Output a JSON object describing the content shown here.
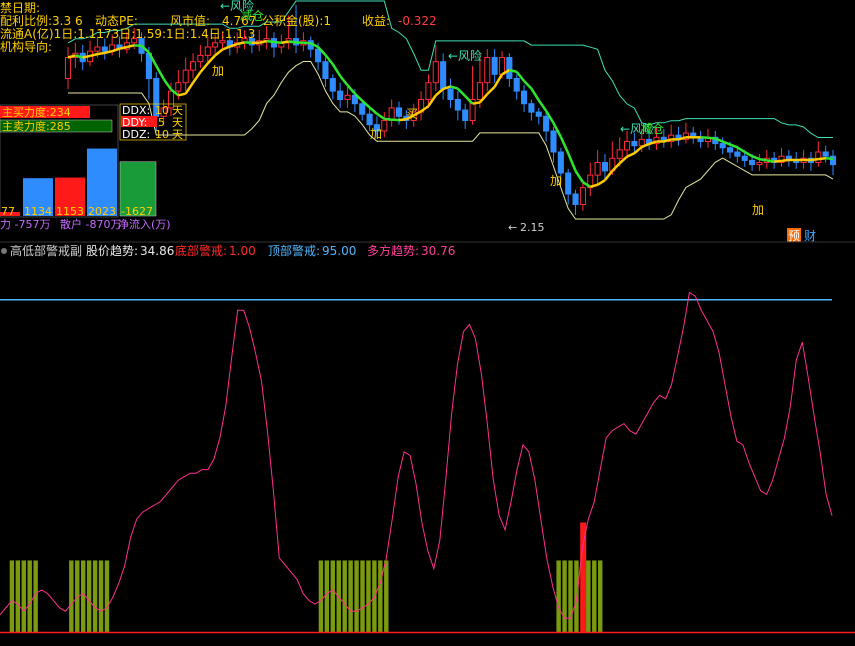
{
  "upper_panel": {
    "info_lines": {
      "line1": "禁日期:",
      "line2": "配利比例:3.3  6",
      "line2b": "动态PE:",
      "line3": "流通A(亿)1日:1.1173日:1.59:1日:1.4日:1.1.3",
      "line4": "机构导向:",
      "market_value_label": "风市值:",
      "market_value": "4.767",
      "fund_label": "公积金(股):1",
      "income_label": "收益:",
      "income_value": "-0.322"
    },
    "annotations": {
      "risk1": "←风险",
      "risk2": "←风险",
      "risk3": "←风险",
      "harvest1": "减仓",
      "harvest2": "减仓",
      "add1": "加",
      "add2": "加",
      "add3": "加",
      "add4": "加",
      "buy": "买",
      "low_price": "2.15",
      "badge_pre": "预",
      "badge_fin": "财"
    },
    "power_box": {
      "buy_force": "主买力度:234",
      "sell_force": "主卖力度:285",
      "ddx_label": "DDX:",
      "ddy_label": "DDY:",
      "ddz_label": "DDZ:",
      "ddx_val": "10",
      "ddy_val": "5",
      "ddz_val": "10",
      "day1": "天",
      "day2": "天",
      "day3": "天",
      "bar_labels": [
        "77",
        "1134",
        "1153",
        "2023",
        "-1627"
      ],
      "bar_values": [
        -77,
        1134,
        1153,
        2023,
        -1627
      ],
      "bottom_line1": "力 -757万",
      "bottom_line2": "散户 -870万",
      "bottom_line3": "净流入(万)"
    }
  },
  "indicator_header": {
    "name": "高低部警戒副",
    "trend_label": "股价趋势:",
    "trend_value": "34.86",
    "bottom_label": "底部警戒:",
    "bottom_value": "1.00",
    "top_label": "顶部警戒:",
    "top_value": "95.00",
    "multi_label": "多方趋势:",
    "multi_value": "30.76"
  },
  "colors": {
    "up": "#ff2a3a",
    "down": "#2f8cff",
    "ma_green": "#2ee62e",
    "ma_yellow": "#ffcc00",
    "band_cyan": "#3fe0b6",
    "band_pink": "#ff4d7d",
    "oscillator": "#ff2f8f",
    "top_line": "#4fb7ff",
    "bottom_line": "#ff1a1a",
    "warn_bar": "#7a9a10",
    "signal_bar": "#ff1a1a"
  },
  "chart_data": {
    "type": "line",
    "title": "高低部警戒副",
    "series": [
      {
        "name": "股价趋势",
        "values": [
          6,
          8,
          10,
          9,
          7,
          9,
          12,
          13,
          12,
          10,
          8,
          7,
          9,
          11,
          12,
          10,
          8,
          7,
          8,
          11,
          15,
          20,
          28,
          33,
          35,
          36,
          37,
          38,
          40,
          42,
          44,
          45,
          46,
          46,
          47,
          47,
          50,
          56,
          65,
          79,
          92,
          92,
          87,
          80,
          72,
          58,
          41,
          22,
          20,
          18,
          16,
          12,
          10,
          9,
          10,
          12,
          13,
          11,
          9,
          7,
          7,
          8,
          9,
          11,
          15,
          22,
          33,
          45,
          52,
          51,
          43,
          32,
          24,
          19,
          27,
          44,
          63,
          77,
          86,
          88,
          84,
          74,
          60,
          44,
          34,
          30,
          38,
          47,
          54,
          52,
          44,
          33,
          22,
          14,
          8,
          5,
          5,
          10,
          25,
          33,
          38,
          47,
          56,
          58,
          59,
          60,
          58,
          57,
          60,
          63,
          66,
          68,
          67,
          71,
          79,
          87,
          97,
          96,
          92,
          89,
          86,
          80,
          71,
          62,
          55,
          54,
          49,
          45,
          41,
          40,
          44,
          50,
          56,
          65,
          78,
          83,
          73,
          62,
          52,
          40,
          34
        ]
      }
    ],
    "reference_lines": [
      {
        "name": "顶部警戒",
        "value": 95
      },
      {
        "name": "底部警戒",
        "value": 1
      }
    ],
    "signal_bar_indices": [
      2,
      3,
      4,
      5,
      6,
      12,
      13,
      14,
      15,
      16,
      17,
      18,
      54,
      55,
      56,
      57,
      58,
      59,
      60,
      61,
      62,
      63,
      64,
      65,
      94,
      95,
      96,
      97,
      98,
      99,
      100,
      101
    ],
    "strong_signal_indices": [
      98
    ],
    "ylim": [
      0,
      100
    ]
  },
  "price_chart": {
    "type": "candlestick",
    "low_marker": 2.15,
    "candles": [
      [
        2.8,
        2.9,
        2.75,
        2.95
      ],
      [
        2.9,
        2.92,
        2.85,
        2.97
      ],
      [
        2.92,
        2.88,
        2.84,
        2.96
      ],
      [
        2.88,
        2.93,
        2.86,
        2.98
      ],
      [
        2.93,
        2.95,
        2.9,
        3.0
      ],
      [
        2.95,
        2.93,
        2.89,
        2.99
      ],
      [
        2.93,
        2.96,
        2.91,
        3.01
      ],
      [
        2.96,
        2.94,
        2.9,
        3.0
      ],
      [
        2.94,
        2.97,
        2.92,
        3.02
      ],
      [
        2.97,
        2.99,
        2.94,
        3.04
      ],
      [
        2.99,
        2.92,
        2.88,
        3.02
      ],
      [
        2.92,
        2.8,
        2.7,
        2.95
      ],
      [
        2.8,
        2.62,
        2.55,
        2.83
      ],
      [
        2.62,
        2.66,
        2.58,
        2.7
      ],
      [
        2.66,
        2.74,
        2.62,
        2.78
      ],
      [
        2.74,
        2.78,
        2.7,
        2.84
      ],
      [
        2.78,
        2.84,
        2.74,
        2.9
      ],
      [
        2.84,
        2.88,
        2.8,
        2.92
      ],
      [
        2.88,
        2.91,
        2.85,
        2.96
      ],
      [
        2.91,
        2.95,
        2.88,
        3.0
      ],
      [
        2.95,
        2.97,
        2.92,
        3.01
      ],
      [
        2.97,
        2.98,
        2.94,
        3.02
      ],
      [
        2.98,
        2.95,
        2.91,
        3.01
      ],
      [
        2.95,
        2.97,
        2.92,
        3.02
      ],
      [
        2.97,
        2.99,
        2.94,
        3.03
      ],
      [
        2.99,
        2.96,
        2.92,
        3.02
      ],
      [
        2.96,
        2.98,
        2.93,
        3.03
      ],
      [
        2.98,
        2.99,
        2.94,
        3.05
      ],
      [
        2.99,
        2.95,
        2.9,
        3.02
      ],
      [
        2.95,
        2.97,
        2.92,
        3.01
      ],
      [
        2.97,
        2.99,
        2.94,
        3.1
      ],
      [
        2.99,
        2.96,
        2.92,
        3.15
      ],
      [
        2.96,
        2.98,
        2.93,
        3.02
      ],
      [
        2.98,
        2.94,
        2.9,
        3.0
      ],
      [
        2.94,
        2.88,
        2.84,
        2.97
      ],
      [
        2.88,
        2.8,
        2.76,
        2.9
      ],
      [
        2.8,
        2.74,
        2.7,
        2.82
      ],
      [
        2.74,
        2.7,
        2.66,
        2.78
      ],
      [
        2.7,
        2.72,
        2.66,
        2.76
      ],
      [
        2.72,
        2.68,
        2.64,
        2.75
      ],
      [
        2.68,
        2.63,
        2.6,
        2.7
      ],
      [
        2.63,
        2.58,
        2.55,
        2.66
      ],
      [
        2.58,
        2.55,
        2.52,
        2.62
      ],
      [
        2.55,
        2.6,
        2.52,
        2.64
      ],
      [
        2.6,
        2.66,
        2.57,
        2.7
      ],
      [
        2.66,
        2.62,
        2.58,
        2.69
      ],
      [
        2.62,
        2.6,
        2.56,
        2.65
      ],
      [
        2.6,
        2.64,
        2.57,
        2.68
      ],
      [
        2.64,
        2.7,
        2.6,
        2.74
      ],
      [
        2.7,
        2.78,
        2.66,
        2.82
      ],
      [
        2.78,
        2.88,
        2.74,
        2.96
      ],
      [
        2.88,
        2.75,
        2.7,
        2.92
      ],
      [
        2.75,
        2.7,
        2.66,
        2.8
      ],
      [
        2.7,
        2.65,
        2.6,
        2.74
      ],
      [
        2.65,
        2.6,
        2.56,
        2.68
      ],
      [
        2.6,
        2.7,
        2.58,
        2.86
      ],
      [
        2.7,
        2.78,
        2.66,
        2.92
      ],
      [
        2.78,
        2.9,
        2.74,
        2.94
      ],
      [
        2.9,
        2.82,
        2.78,
        2.94
      ],
      [
        2.82,
        2.9,
        2.8,
        2.93
      ],
      [
        2.9,
        2.8,
        2.76,
        2.92
      ],
      [
        2.8,
        2.74,
        2.7,
        2.82
      ],
      [
        2.74,
        2.68,
        2.64,
        2.77
      ],
      [
        2.68,
        2.64,
        2.6,
        2.7
      ],
      [
        2.64,
        2.62,
        2.58,
        2.66
      ],
      [
        2.62,
        2.55,
        2.5,
        2.64
      ],
      [
        2.55,
        2.45,
        2.4,
        2.57
      ],
      [
        2.45,
        2.35,
        2.3,
        2.47
      ],
      [
        2.35,
        2.25,
        2.2,
        2.37
      ],
      [
        2.25,
        2.2,
        2.15,
        2.27
      ],
      [
        2.2,
        2.28,
        2.17,
        2.32
      ],
      [
        2.28,
        2.34,
        2.24,
        2.4
      ],
      [
        2.34,
        2.4,
        2.3,
        2.46
      ],
      [
        2.4,
        2.36,
        2.32,
        2.44
      ],
      [
        2.36,
        2.42,
        2.34,
        2.5
      ],
      [
        2.42,
        2.46,
        2.38,
        2.52
      ],
      [
        2.46,
        2.5,
        2.42,
        2.55
      ],
      [
        2.5,
        2.48,
        2.44,
        2.54
      ],
      [
        2.48,
        2.51,
        2.45,
        2.56
      ],
      [
        2.51,
        2.49,
        2.46,
        2.55
      ],
      [
        2.49,
        2.52,
        2.46,
        2.57
      ],
      [
        2.52,
        2.5,
        2.47,
        2.56
      ],
      [
        2.5,
        2.53,
        2.47,
        2.58
      ],
      [
        2.53,
        2.51,
        2.48,
        2.57
      ],
      [
        2.51,
        2.54,
        2.49,
        2.59
      ],
      [
        2.54,
        2.52,
        2.49,
        2.57
      ],
      [
        2.52,
        2.5,
        2.47,
        2.55
      ],
      [
        2.5,
        2.52,
        2.47,
        2.56
      ],
      [
        2.52,
        2.49,
        2.46,
        2.55
      ],
      [
        2.49,
        2.47,
        2.44,
        2.52
      ],
      [
        2.47,
        2.45,
        2.42,
        2.5
      ],
      [
        2.45,
        2.43,
        2.4,
        2.48
      ],
      [
        2.43,
        2.41,
        2.38,
        2.46
      ],
      [
        2.41,
        2.39,
        2.36,
        2.44
      ],
      [
        2.39,
        2.4,
        2.36,
        2.44
      ],
      [
        2.4,
        2.42,
        2.37,
        2.46
      ],
      [
        2.42,
        2.4,
        2.37,
        2.45
      ],
      [
        2.4,
        2.43,
        2.38,
        2.47
      ],
      [
        2.43,
        2.41,
        2.38,
        2.46
      ],
      [
        2.41,
        2.4,
        2.37,
        2.45
      ],
      [
        2.4,
        2.42,
        2.37,
        2.46
      ],
      [
        2.42,
        2.4,
        2.36,
        2.45
      ],
      [
        2.4,
        2.45,
        2.38,
        2.5
      ],
      [
        2.45,
        2.43,
        2.4,
        2.48
      ],
      [
        2.43,
        2.39,
        2.34,
        2.46
      ]
    ]
  }
}
